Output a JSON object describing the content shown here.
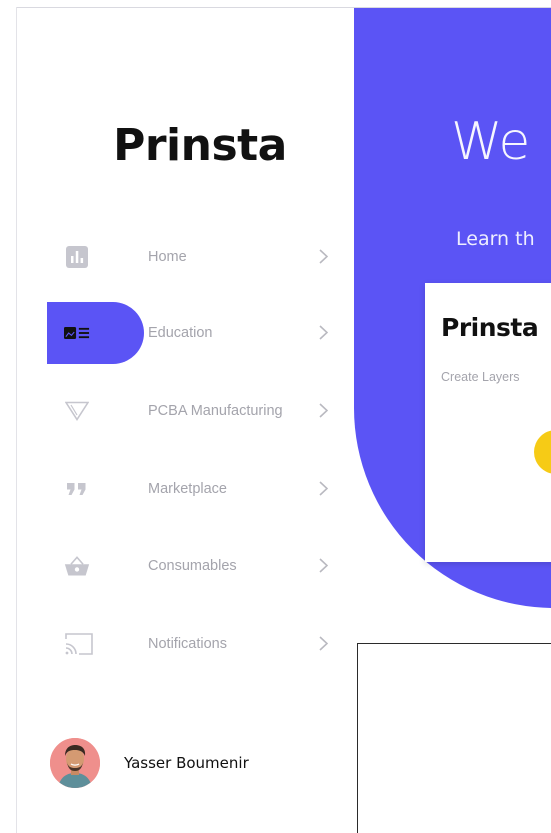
{
  "sidebar": {
    "brand": "Prinsta",
    "items": [
      {
        "label": "Home",
        "icon": "bar-chart-icon",
        "active": false
      },
      {
        "label": "Education",
        "icon": "education-card-icon",
        "active": true
      },
      {
        "label": "PCBA Manufacturing",
        "icon": "triangle-down-icon",
        "active": false
      },
      {
        "label": "Marketplace",
        "icon": "quote-icon",
        "active": false
      },
      {
        "label": "Consumables",
        "icon": "basket-icon",
        "active": false
      },
      {
        "label": "Notifications",
        "icon": "cast-icon",
        "active": false
      }
    ],
    "user": {
      "name": "Yasser Boumenir",
      "avatar": "user-avatar"
    }
  },
  "main": {
    "welcome": "We",
    "subtitle": "Learn th",
    "card": {
      "title": "Prinsta",
      "subtitle": "Create Layers"
    }
  },
  "colors": {
    "accent": "#5b54f5",
    "muted_text": "#a4a4ac",
    "icon_gray": "#c6c6ce",
    "yellow": "#f6cb16",
    "avatar_bg": "#ef8f8c"
  }
}
